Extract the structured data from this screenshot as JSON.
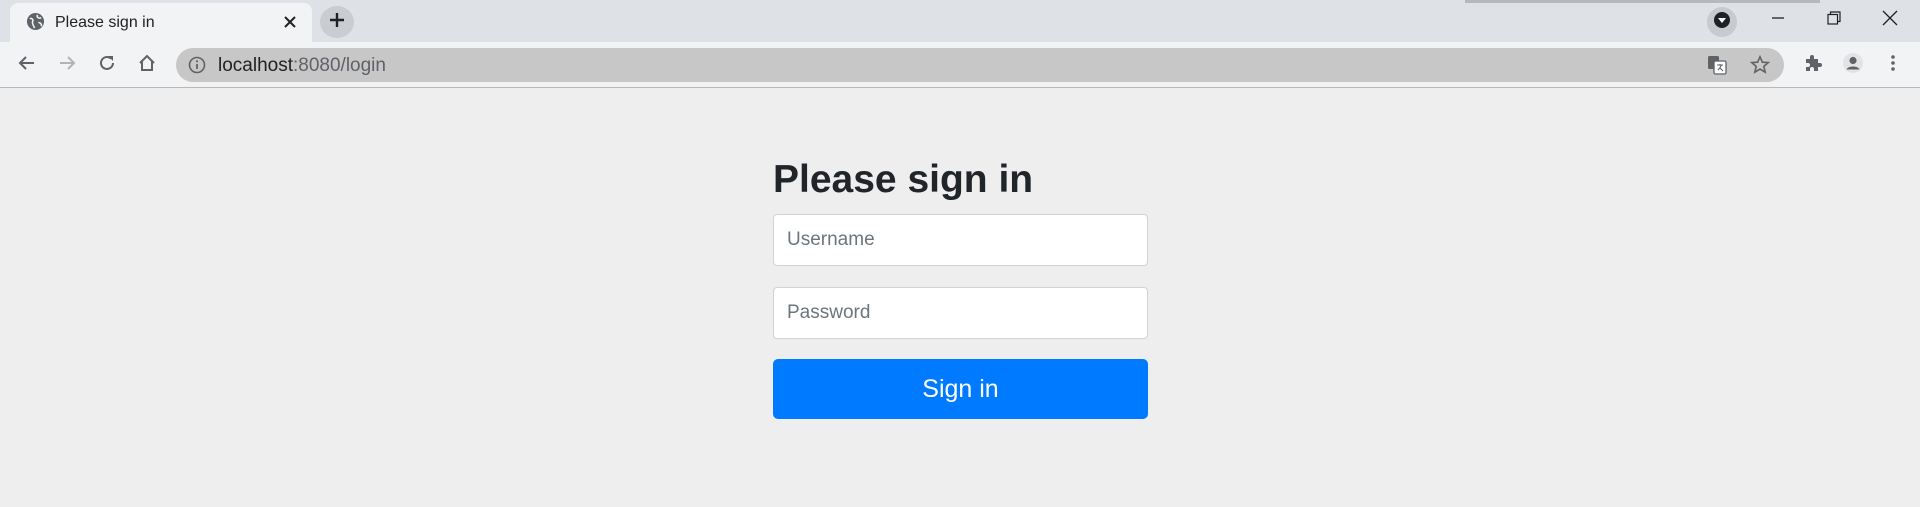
{
  "browser": {
    "tab": {
      "title": "Please sign in"
    },
    "address": {
      "host": "localhost",
      "rest": ":8080/login"
    }
  },
  "page": {
    "heading": "Please sign in",
    "username": {
      "placeholder": "Username",
      "value": ""
    },
    "password": {
      "placeholder": "Password",
      "value": ""
    },
    "submit_label": "Sign in"
  },
  "colors": {
    "accent": "#007bff",
    "page_bg": "#eeeeee",
    "heading": "#212529"
  },
  "icons": [
    "globe-icon",
    "close-icon",
    "plus-icon",
    "tab-search-icon",
    "minimize-icon",
    "restore-icon",
    "window-close-icon",
    "back-arrow-icon",
    "forward-arrow-icon",
    "reload-icon",
    "home-icon",
    "info-icon",
    "translate-icon",
    "star-icon",
    "extensions-icon",
    "profile-icon",
    "menu-kebab-icon"
  ]
}
